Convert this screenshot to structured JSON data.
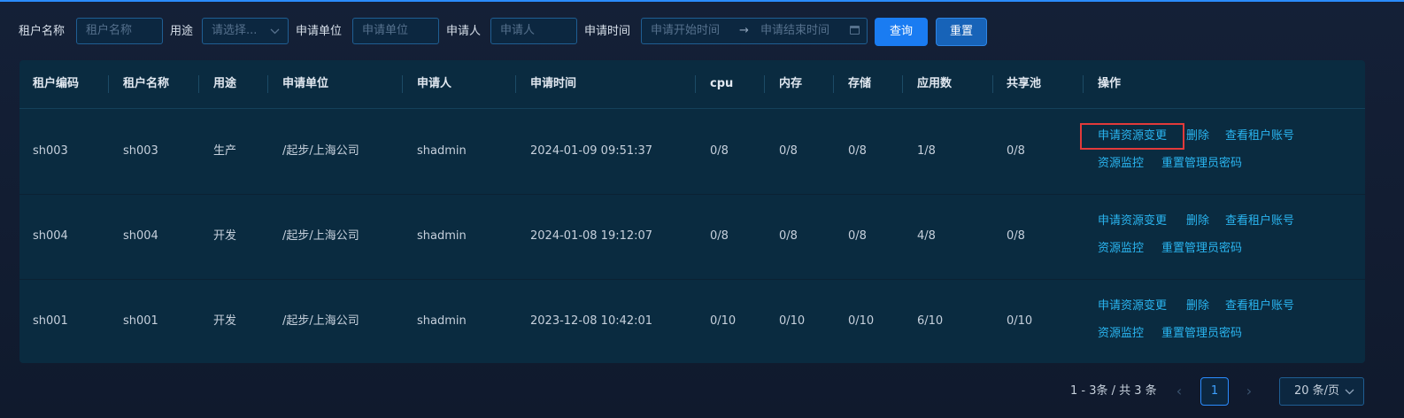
{
  "search": {
    "tenant_name_label": "租户名称",
    "tenant_name_placeholder": "租户名称",
    "purpose_label": "用途",
    "purpose_placeholder": "请选择...",
    "unit_label": "申请单位",
    "unit_placeholder": "申请单位",
    "applicant_label": "申请人",
    "applicant_placeholder": "申请人",
    "time_label": "申请时间",
    "time_start_placeholder": "申请开始时间",
    "time_end_placeholder": "申请结束时间",
    "query_button": "查询",
    "reset_button": "重置"
  },
  "table": {
    "columns": [
      "租户编码",
      "租户名称",
      "用途",
      "申请单位",
      "申请人",
      "申请时间",
      "cpu",
      "内存",
      "存储",
      "应用数",
      "共享池",
      "操作"
    ],
    "rows": [
      {
        "code": "sh003",
        "name": "sh003",
        "purpose": "生产",
        "unit": "/起步/上海公司",
        "applicant": "shadmin",
        "time": "2024-01-09 09:51:37",
        "cpu": "0/8",
        "memory": "0/8",
        "storage": "0/8",
        "apps": "1/8",
        "pool": "0/8"
      },
      {
        "code": "sh004",
        "name": "sh004",
        "purpose": "开发",
        "unit": "/起步/上海公司",
        "applicant": "shadmin",
        "time": "2024-01-08 19:12:07",
        "cpu": "0/8",
        "memory": "0/8",
        "storage": "0/8",
        "apps": "4/8",
        "pool": "0/8"
      },
      {
        "code": "sh001",
        "name": "sh001",
        "purpose": "开发",
        "unit": "/起步/上海公司",
        "applicant": "shadmin",
        "time": "2023-12-08 10:42:01",
        "cpu": "0/10",
        "memory": "0/10",
        "storage": "0/10",
        "apps": "6/10",
        "pool": "0/10"
      }
    ],
    "actions": {
      "change": "申请资源变更",
      "delete": "删除",
      "view_account": "查看租户账号",
      "monitor": "资源监控",
      "reset_password": "重置管理员密码"
    }
  },
  "pagination": {
    "total_text": "1 - 3条 / 共 3 条",
    "current_page": "1",
    "page_size": "20 条/页",
    "prev_icon": "‹",
    "next_icon": "›"
  },
  "colors": {
    "accent": "#1a7cf2",
    "link": "#2ab5f0",
    "highlight": "#e23a3a"
  }
}
